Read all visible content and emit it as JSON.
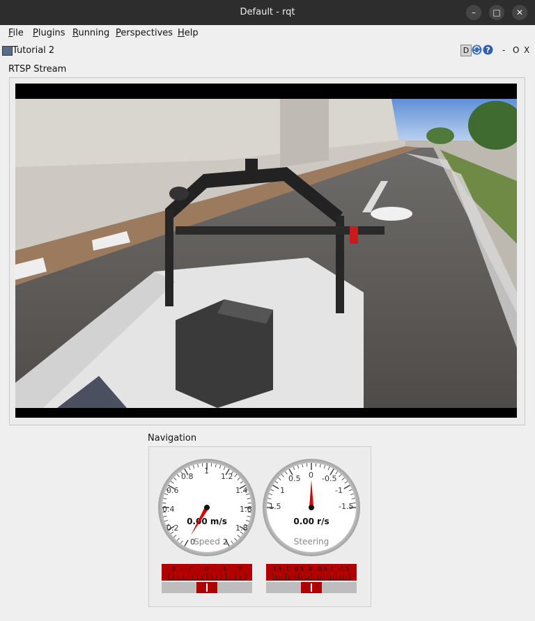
{
  "window": {
    "title": "Default - rqt",
    "minimize": "–",
    "maximize": "□",
    "close": "✕"
  },
  "menu": [
    {
      "mnemonic": "F",
      "rest": "ile"
    },
    {
      "mnemonic": "P",
      "rest": "lugins"
    },
    {
      "mnemonic": "R",
      "rest": "unning"
    },
    {
      "mnemonic": "P",
      "rest": "erspectives"
    },
    {
      "mnemonic": "H",
      "rest": "elp"
    }
  ],
  "plugin": {
    "title": "Tutorial 2",
    "d_label": "D",
    "reload_icon": "reload-icon",
    "help_icon": "help-icon",
    "minimize": "-",
    "float": "O",
    "close": "X"
  },
  "stream": {
    "label": "RTSP Stream"
  },
  "navigation": {
    "label": "Navigation",
    "speed_gauge": {
      "value_text": "0.00 m/s",
      "caption": "Speed",
      "ticks": [
        "0",
        "0.2",
        "0.4",
        "0.6",
        "0.8",
        "1",
        "1.2",
        "1.4",
        "1.6",
        "1.8",
        "2"
      ],
      "value": 0.0,
      "min": 0,
      "max": 2
    },
    "steering_gauge": {
      "value_text": "0.00 r/s",
      "caption": "Steering",
      "ticks": [
        "1.5",
        "1",
        "0.5",
        "0",
        "-0.5",
        "-1",
        "-1.5"
      ],
      "value": 0.0
    },
    "speed_slider": {
      "ticks": [
        "-2",
        "-1",
        "0",
        "1",
        "2"
      ],
      "value": 0
    },
    "steering_slider": {
      "ticks": [
        "1.5",
        "1",
        "0.5",
        "0",
        "-0.5",
        "-1",
        "-1.5"
      ],
      "value": 0
    }
  },
  "colors": {
    "accent_red": "#b00000",
    "needle": "#e00000",
    "titlebar": "#2d2d2d"
  }
}
